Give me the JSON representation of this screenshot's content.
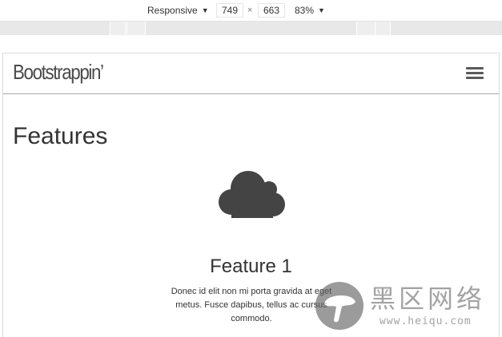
{
  "devtools": {
    "device_mode": "Responsive",
    "width": "749",
    "height": "663",
    "zoom": "83%",
    "dimension_separator": "×",
    "dropdown_icon": "triangle-down-icon"
  },
  "site": {
    "brand": "Bootstrappin’",
    "menu_icon": "hamburger-menu-icon",
    "section_title": "Features",
    "feature": {
      "icon": "cloud-icon",
      "title": "Feature 1",
      "text": "Donec id elit non mi porta gravida at eget metus. Fusce dapibus, tellus ac cursus commodo."
    }
  },
  "watermark": {
    "logo": "mushroom-logo",
    "name": "黑区网络",
    "url": "www.heiqu.com"
  },
  "colors": {
    "icon": "#444444",
    "text": "#333333",
    "nav_border": "#a9a9a9",
    "media_bar": "#e8e8e8"
  }
}
